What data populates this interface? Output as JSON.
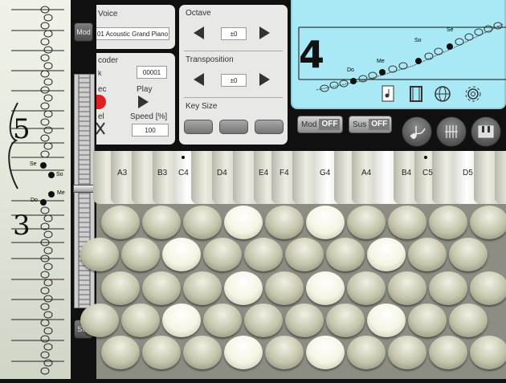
{
  "staff": {
    "notes": [
      "So",
      "Me",
      "Do",
      "Se"
    ]
  },
  "sidebar": {
    "mod_label": "Mod",
    "sus_label": "Sus"
  },
  "voice": {
    "label": "Voice",
    "value": "01 Acoustic Grand Piano"
  },
  "recorder": {
    "label": "coder",
    "counter": "00001",
    "rec_label": "ec",
    "play_label": "Play",
    "del_label": "el",
    "speed_label": "Speed [%]",
    "speed_value": "100"
  },
  "octave": {
    "label": "Octave",
    "value": "±0"
  },
  "transposition": {
    "label": "Transposition",
    "value": "±0"
  },
  "key_size": {
    "label": "Key Size"
  },
  "score": {
    "time_sig": "4",
    "notes": [
      "Do",
      "Me",
      "So",
      "Se"
    ]
  },
  "toggles": {
    "mod_label": "Mod",
    "mod_state": "OFF",
    "sus_label": "Sus",
    "sus_state": "OFF"
  },
  "keyboard": {
    "labels": [
      "A3",
      "B3",
      "C4",
      "D4",
      "E4",
      "F4",
      "G4",
      "A4",
      "B4",
      "C5",
      "D5"
    ]
  },
  "colors": {
    "score_bg": "#a9e9f5",
    "rec_red": "#e02020"
  }
}
